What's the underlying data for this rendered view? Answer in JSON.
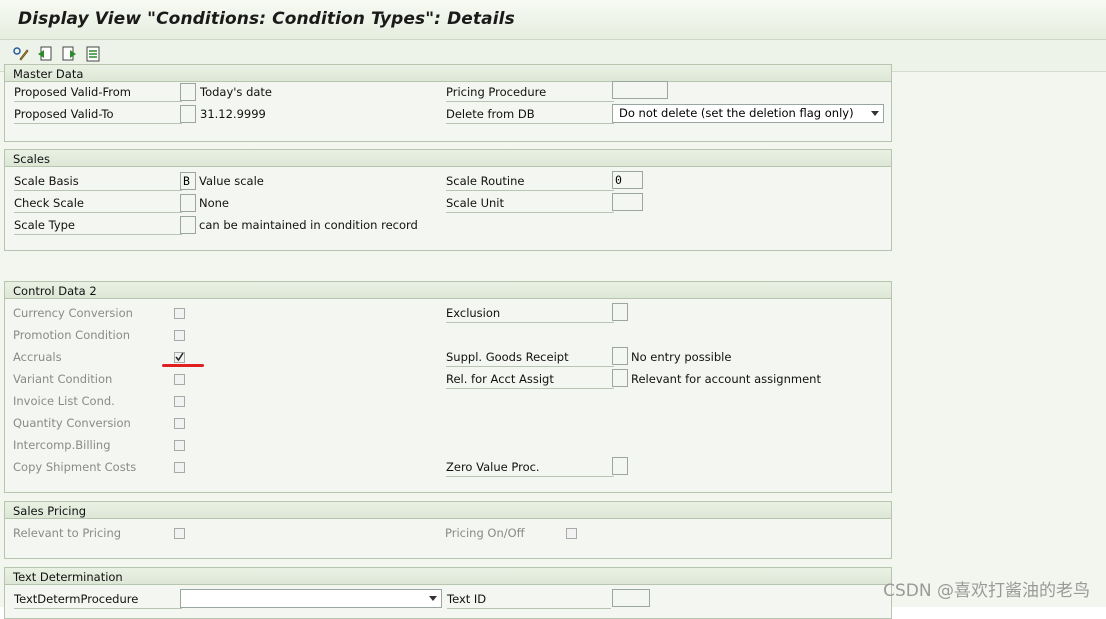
{
  "window": {
    "title": "Display View \"Conditions: Condition Types\": Details"
  },
  "toolbar": {
    "icons": [
      "display-change-icon",
      "previous-entry-icon",
      "next-entry-icon",
      "other-entry-icon"
    ]
  },
  "master_data": {
    "title": "Master Data",
    "proposed_valid_from": {
      "label": "Proposed Valid-From",
      "value": "",
      "desc": "Today's date"
    },
    "proposed_valid_to": {
      "label": "Proposed Valid-To",
      "value": "",
      "desc": "31.12.9999"
    },
    "pricing_procedure": {
      "label": "Pricing Procedure",
      "value": ""
    },
    "delete_from_db": {
      "label": "Delete from DB",
      "value": "Do not delete (set the deletion flag only)"
    }
  },
  "scales": {
    "title": "Scales",
    "scale_basis": {
      "label": "Scale Basis",
      "value": "B",
      "desc": "Value scale"
    },
    "check_scale": {
      "label": "Check Scale",
      "value": "",
      "desc": "None"
    },
    "scale_type": {
      "label": "Scale Type",
      "value": "",
      "desc": "can be maintained in condition record"
    },
    "scale_routine": {
      "label": "Scale Routine",
      "value": "0"
    },
    "scale_unit": {
      "label": "Scale Unit",
      "value": ""
    }
  },
  "control_data_2": {
    "title": "Control Data 2",
    "checkboxes": [
      {
        "label": "Currency Conversion",
        "checked": false
      },
      {
        "label": "Promotion Condition",
        "checked": false
      },
      {
        "label": "Accruals",
        "checked": true
      },
      {
        "label": "Variant Condition",
        "checked": false
      },
      {
        "label": "Invoice List Cond.",
        "checked": false
      },
      {
        "label": "Quantity Conversion",
        "checked": false
      },
      {
        "label": "Intercomp.Billing",
        "checked": false
      },
      {
        "label": "Copy Shipment Costs",
        "checked": false
      }
    ],
    "exclusion": {
      "label": "Exclusion",
      "value": ""
    },
    "suppl_goods_receipt": {
      "label": "Suppl. Goods Receipt",
      "value": "",
      "desc": "No entry possible"
    },
    "rel_acct_assig": {
      "label": "Rel. for Acct Assigt",
      "value": "",
      "desc": "Relevant for account assignment"
    },
    "zero_value_proc": {
      "label": "Zero Value Proc.",
      "value": ""
    }
  },
  "sales_pricing": {
    "title": "Sales Pricing",
    "relevant_to_pricing": {
      "label": "Relevant to Pricing",
      "checked": false
    },
    "pricing_on_off": {
      "label": "Pricing On/Off",
      "checked": false
    }
  },
  "text_determination": {
    "title": "Text Determination",
    "procedure": {
      "label": "TextDetermProcedure",
      "value": ""
    },
    "text_id": {
      "label": "Text ID",
      "value": ""
    }
  },
  "watermark": "CSDN @喜欢打酱油的老鸟",
  "colors": {
    "annotation_underline": "#e02020",
    "frame_border": "#b7c4ae",
    "header_bg": "#dde7d6"
  }
}
